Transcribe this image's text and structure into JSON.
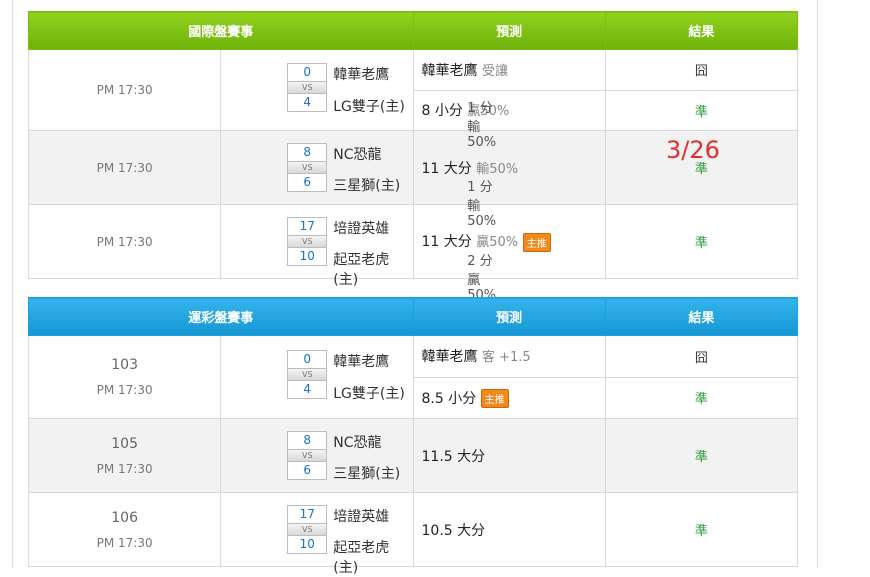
{
  "intl": {
    "headers": {
      "match": "國際盤賽事",
      "pred": "預測",
      "result": "結果"
    },
    "rows": [
      {
        "time": "PM 17:30",
        "score_away": "0",
        "score_home": "4",
        "vs": "VS",
        "team_away": "韓華老鷹",
        "team_home": "LG雙子(主)",
        "odds": "1 分輸50%",
        "pred": [
          {
            "main": "韓華老鷹",
            "sub": "受讓",
            "badge": "",
            "result": "囧"
          },
          {
            "main": "8 小分",
            "sub": "贏50%",
            "badge": "",
            "result": "準"
          }
        ]
      },
      {
        "time": "PM 17:30",
        "score_away": "8",
        "score_home": "6",
        "vs": "VS",
        "team_away": "NC恐龍",
        "team_home": "三星獅(主)",
        "odds": "1 分輸50%",
        "pred": [
          {
            "main": "11 大分",
            "sub": "輸50%",
            "badge": "",
            "result": "準"
          }
        ]
      },
      {
        "time": "PM 17:30",
        "score_away": "17",
        "score_home": "10",
        "vs": "VS",
        "team_away": "培證英雄",
        "team_home": "起亞老虎(主)",
        "odds": "2 分贏50%",
        "pred": [
          {
            "main": "11 大分",
            "sub": "贏50%",
            "badge": "主推",
            "result": "準"
          }
        ]
      }
    ]
  },
  "lottery": {
    "headers": {
      "match": "運彩盤賽事",
      "pred": "預測",
      "result": "結果"
    },
    "rows": [
      {
        "num": "103",
        "time": "PM 17:30",
        "score_away": "0",
        "score_home": "4",
        "vs": "VS",
        "team_away": "韓華老鷹",
        "team_home": "LG雙子(主)",
        "pred": [
          {
            "main": "韓華老鷹",
            "sub": "客 +1.5",
            "badge": "",
            "result": "囧"
          },
          {
            "main": "8.5 小分",
            "sub": "",
            "badge": "主推",
            "result": "準"
          }
        ]
      },
      {
        "num": "105",
        "time": "PM 17:30",
        "score_away": "8",
        "score_home": "6",
        "vs": "VS",
        "team_away": "NC恐龍",
        "team_home": "三星獅(主)",
        "pred": [
          {
            "main": "11.5 大分",
            "sub": "",
            "badge": "",
            "result": "準"
          }
        ]
      },
      {
        "num": "106",
        "time": "PM 17:30",
        "score_away": "17",
        "score_home": "10",
        "vs": "VS",
        "team_away": "培證英雄",
        "team_home": "起亞老虎(主)",
        "pred": [
          {
            "main": "10.5 大分",
            "sub": "",
            "badge": "",
            "result": "準"
          }
        ]
      }
    ]
  },
  "annotation": "3/26",
  "colors": {
    "intl_header": "#7cbf12",
    "lottery_header": "#1e9fdd",
    "result_ok": "#2a9d3a",
    "annotation": "#e03030",
    "badge": "#f08a1c"
  }
}
